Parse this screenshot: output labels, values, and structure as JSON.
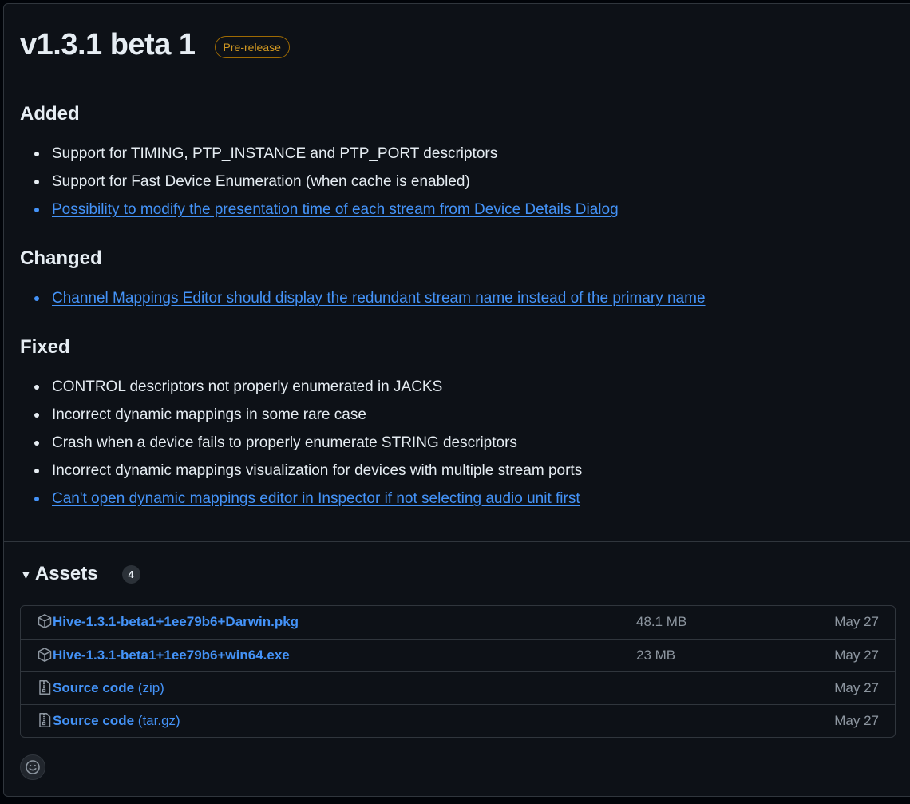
{
  "release": {
    "title": "v1.3.1 beta 1",
    "badge": "Pre-release"
  },
  "sections": {
    "added": {
      "heading": "Added",
      "items": [
        {
          "text": "Support for TIMING, PTP_INSTANCE and PTP_PORT descriptors"
        },
        {
          "text": "Support for Fast Device Enumeration (when cache is enabled)"
        },
        {
          "text": "Possibility to modify the presentation time of each stream from Device Details Dialog",
          "link": true
        }
      ]
    },
    "changed": {
      "heading": "Changed",
      "items": [
        {
          "text": "Channel Mappings Editor should display the redundant stream name instead of the primary name",
          "link": true
        }
      ]
    },
    "fixed": {
      "heading": "Fixed",
      "items": [
        {
          "text": "CONTROL descriptors not properly enumerated in JACKS"
        },
        {
          "text": "Incorrect dynamic mappings in some rare case"
        },
        {
          "text": "Crash when a device fails to properly enumerate STRING descriptors"
        },
        {
          "text": "Incorrect dynamic mappings visualization for devices with multiple stream ports"
        },
        {
          "text": "Can't open dynamic mappings editor in Inspector if not selecting audio unit first",
          "link": true
        }
      ]
    }
  },
  "assets": {
    "title": "Assets",
    "count": "4",
    "items": [
      {
        "icon": "package-icon",
        "name": "Hive-1.3.1-beta1+1ee79b6+Darwin.pkg",
        "ext": "",
        "size": "48.1 MB",
        "date": "May 27"
      },
      {
        "icon": "package-icon",
        "name": "Hive-1.3.1-beta1+1ee79b6+win64.exe",
        "ext": "",
        "size": "23 MB",
        "date": "May 27"
      },
      {
        "icon": "file-zip-icon",
        "name": "Source code",
        "ext": "(zip)",
        "size": "",
        "date": "May 27"
      },
      {
        "icon": "file-zip-icon",
        "name": "Source code",
        "ext": "(tar.gz)",
        "size": "",
        "date": "May 27"
      }
    ]
  },
  "colors": {
    "background": "#0d1117",
    "link": "#4493f8",
    "badge": "#d29922",
    "muted": "#8d96a0"
  }
}
